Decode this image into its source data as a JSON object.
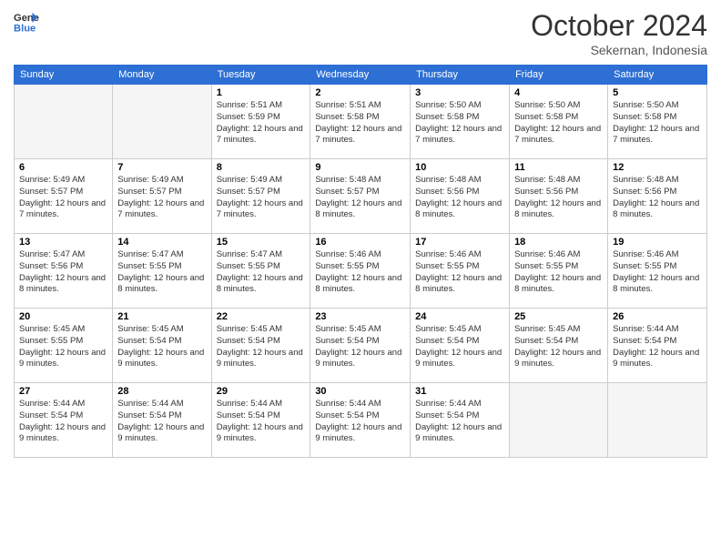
{
  "header": {
    "logo_line1": "General",
    "logo_line2": "Blue",
    "month": "October 2024",
    "location": "Sekernan, Indonesia"
  },
  "days_of_week": [
    "Sunday",
    "Monday",
    "Tuesday",
    "Wednesday",
    "Thursday",
    "Friday",
    "Saturday"
  ],
  "weeks": [
    [
      {
        "day": "",
        "sunrise": "",
        "sunset": "",
        "daylight": ""
      },
      {
        "day": "",
        "sunrise": "",
        "sunset": "",
        "daylight": ""
      },
      {
        "day": "1",
        "sunrise": "Sunrise: 5:51 AM",
        "sunset": "Sunset: 5:59 PM",
        "daylight": "Daylight: 12 hours and 7 minutes."
      },
      {
        "day": "2",
        "sunrise": "Sunrise: 5:51 AM",
        "sunset": "Sunset: 5:58 PM",
        "daylight": "Daylight: 12 hours and 7 minutes."
      },
      {
        "day": "3",
        "sunrise": "Sunrise: 5:50 AM",
        "sunset": "Sunset: 5:58 PM",
        "daylight": "Daylight: 12 hours and 7 minutes."
      },
      {
        "day": "4",
        "sunrise": "Sunrise: 5:50 AM",
        "sunset": "Sunset: 5:58 PM",
        "daylight": "Daylight: 12 hours and 7 minutes."
      },
      {
        "day": "5",
        "sunrise": "Sunrise: 5:50 AM",
        "sunset": "Sunset: 5:58 PM",
        "daylight": "Daylight: 12 hours and 7 minutes."
      }
    ],
    [
      {
        "day": "6",
        "sunrise": "Sunrise: 5:49 AM",
        "sunset": "Sunset: 5:57 PM",
        "daylight": "Daylight: 12 hours and 7 minutes."
      },
      {
        "day": "7",
        "sunrise": "Sunrise: 5:49 AM",
        "sunset": "Sunset: 5:57 PM",
        "daylight": "Daylight: 12 hours and 7 minutes."
      },
      {
        "day": "8",
        "sunrise": "Sunrise: 5:49 AM",
        "sunset": "Sunset: 5:57 PM",
        "daylight": "Daylight: 12 hours and 7 minutes."
      },
      {
        "day": "9",
        "sunrise": "Sunrise: 5:48 AM",
        "sunset": "Sunset: 5:57 PM",
        "daylight": "Daylight: 12 hours and 8 minutes."
      },
      {
        "day": "10",
        "sunrise": "Sunrise: 5:48 AM",
        "sunset": "Sunset: 5:56 PM",
        "daylight": "Daylight: 12 hours and 8 minutes."
      },
      {
        "day": "11",
        "sunrise": "Sunrise: 5:48 AM",
        "sunset": "Sunset: 5:56 PM",
        "daylight": "Daylight: 12 hours and 8 minutes."
      },
      {
        "day": "12",
        "sunrise": "Sunrise: 5:48 AM",
        "sunset": "Sunset: 5:56 PM",
        "daylight": "Daylight: 12 hours and 8 minutes."
      }
    ],
    [
      {
        "day": "13",
        "sunrise": "Sunrise: 5:47 AM",
        "sunset": "Sunset: 5:56 PM",
        "daylight": "Daylight: 12 hours and 8 minutes."
      },
      {
        "day": "14",
        "sunrise": "Sunrise: 5:47 AM",
        "sunset": "Sunset: 5:55 PM",
        "daylight": "Daylight: 12 hours and 8 minutes."
      },
      {
        "day": "15",
        "sunrise": "Sunrise: 5:47 AM",
        "sunset": "Sunset: 5:55 PM",
        "daylight": "Daylight: 12 hours and 8 minutes."
      },
      {
        "day": "16",
        "sunrise": "Sunrise: 5:46 AM",
        "sunset": "Sunset: 5:55 PM",
        "daylight": "Daylight: 12 hours and 8 minutes."
      },
      {
        "day": "17",
        "sunrise": "Sunrise: 5:46 AM",
        "sunset": "Sunset: 5:55 PM",
        "daylight": "Daylight: 12 hours and 8 minutes."
      },
      {
        "day": "18",
        "sunrise": "Sunrise: 5:46 AM",
        "sunset": "Sunset: 5:55 PM",
        "daylight": "Daylight: 12 hours and 8 minutes."
      },
      {
        "day": "19",
        "sunrise": "Sunrise: 5:46 AM",
        "sunset": "Sunset: 5:55 PM",
        "daylight": "Daylight: 12 hours and 8 minutes."
      }
    ],
    [
      {
        "day": "20",
        "sunrise": "Sunrise: 5:45 AM",
        "sunset": "Sunset: 5:55 PM",
        "daylight": "Daylight: 12 hours and 9 minutes."
      },
      {
        "day": "21",
        "sunrise": "Sunrise: 5:45 AM",
        "sunset": "Sunset: 5:54 PM",
        "daylight": "Daylight: 12 hours and 9 minutes."
      },
      {
        "day": "22",
        "sunrise": "Sunrise: 5:45 AM",
        "sunset": "Sunset: 5:54 PM",
        "daylight": "Daylight: 12 hours and 9 minutes."
      },
      {
        "day": "23",
        "sunrise": "Sunrise: 5:45 AM",
        "sunset": "Sunset: 5:54 PM",
        "daylight": "Daylight: 12 hours and 9 minutes."
      },
      {
        "day": "24",
        "sunrise": "Sunrise: 5:45 AM",
        "sunset": "Sunset: 5:54 PM",
        "daylight": "Daylight: 12 hours and 9 minutes."
      },
      {
        "day": "25",
        "sunrise": "Sunrise: 5:45 AM",
        "sunset": "Sunset: 5:54 PM",
        "daylight": "Daylight: 12 hours and 9 minutes."
      },
      {
        "day": "26",
        "sunrise": "Sunrise: 5:44 AM",
        "sunset": "Sunset: 5:54 PM",
        "daylight": "Daylight: 12 hours and 9 minutes."
      }
    ],
    [
      {
        "day": "27",
        "sunrise": "Sunrise: 5:44 AM",
        "sunset": "Sunset: 5:54 PM",
        "daylight": "Daylight: 12 hours and 9 minutes."
      },
      {
        "day": "28",
        "sunrise": "Sunrise: 5:44 AM",
        "sunset": "Sunset: 5:54 PM",
        "daylight": "Daylight: 12 hours and 9 minutes."
      },
      {
        "day": "29",
        "sunrise": "Sunrise: 5:44 AM",
        "sunset": "Sunset: 5:54 PM",
        "daylight": "Daylight: 12 hours and 9 minutes."
      },
      {
        "day": "30",
        "sunrise": "Sunrise: 5:44 AM",
        "sunset": "Sunset: 5:54 PM",
        "daylight": "Daylight: 12 hours and 9 minutes."
      },
      {
        "day": "31",
        "sunrise": "Sunrise: 5:44 AM",
        "sunset": "Sunset: 5:54 PM",
        "daylight": "Daylight: 12 hours and 9 minutes."
      },
      {
        "day": "",
        "sunrise": "",
        "sunset": "",
        "daylight": ""
      },
      {
        "day": "",
        "sunrise": "",
        "sunset": "",
        "daylight": ""
      }
    ]
  ]
}
